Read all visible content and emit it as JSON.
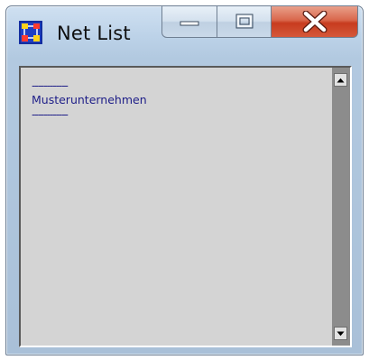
{
  "window": {
    "title": "Net List",
    "icon": "net-list-app-icon"
  },
  "caption_buttons": {
    "minimize": "minimize-icon",
    "maximize": "maximize-icon",
    "close": "close-icon"
  },
  "list": {
    "items": [
      "------------",
      "Musterunternehmen",
      "------------"
    ]
  },
  "scrollbar": {
    "up": "scroll-up-arrow-icon",
    "down": "scroll-down-arrow-icon"
  },
  "colors": {
    "text": "#1e1e88",
    "list_background": "#d4d4d4",
    "close_button": "#c73b1e"
  }
}
